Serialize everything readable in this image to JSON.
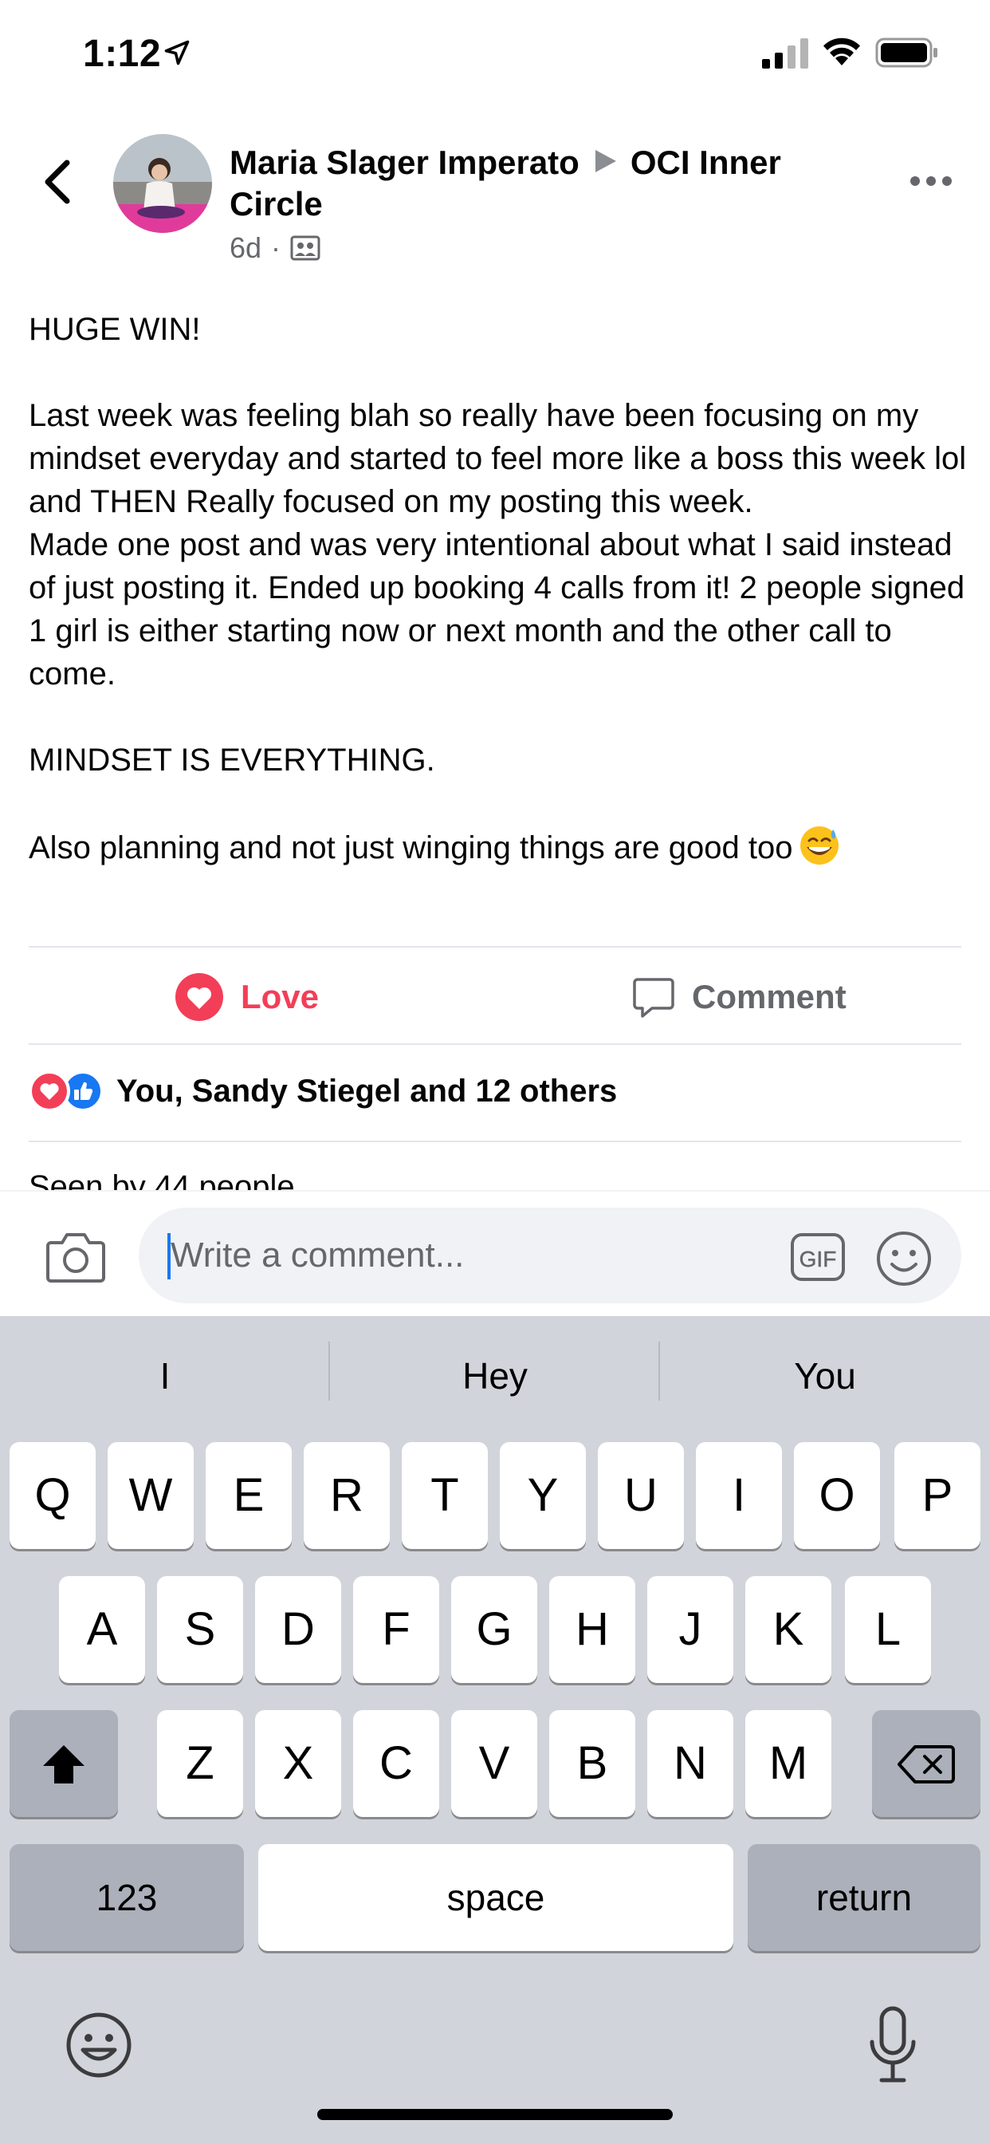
{
  "status_bar": {
    "time": "1:12"
  },
  "post": {
    "author": "Maria Slager Imperato",
    "group": "OCI Inner Circle",
    "age": "6d",
    "separator_dot": "·",
    "body": {
      "line_1": "HUGE WIN!",
      "para_1": "Last week was feeling blah so really have been focusing on my mindset everyday and started to feel more like a boss this week lol and THEN Really focused on my posting this week.",
      "para_2": "Made one post and was very intentional about what I said instead of just posting it. Ended up booking 4 calls from it! 2 people signed 1 girl is either starting now or next month and the other call to come.",
      "line_2": "MINDSET IS EVERYTHING.",
      "line_3": "Also planning and not just winging things are good too"
    }
  },
  "actions": {
    "love_label": "Love",
    "comment_label": "Comment"
  },
  "reactions": {
    "summary": "You, Sandy Stiegel and 12 others"
  },
  "seen_by": "Seen by 44 people",
  "comment_bar": {
    "placeholder": "Write a comment..."
  },
  "keyboard": {
    "suggestions": [
      "I",
      "Hey",
      "You"
    ],
    "row1": [
      "Q",
      "W",
      "E",
      "R",
      "T",
      "Y",
      "U",
      "I",
      "O",
      "P"
    ],
    "row2": [
      "A",
      "S",
      "D",
      "F",
      "G",
      "H",
      "J",
      "K",
      "L"
    ],
    "row3": [
      "Z",
      "X",
      "C",
      "V",
      "B",
      "N",
      "M"
    ],
    "numbers_label": "123",
    "space_label": "space",
    "return_label": "return"
  },
  "colors": {
    "love_red": "#f33e58",
    "like_blue": "#1877f2",
    "secondary_text": "#65676b",
    "keyboard_bg": "#d1d4da"
  },
  "icons": [
    "location-arrow-icon",
    "signal-icon",
    "wifi-icon",
    "battery-icon",
    "back-icon",
    "more-icon",
    "group-icon",
    "heart-icon",
    "comment-icon",
    "like-icon",
    "camera-icon",
    "gif-icon",
    "smiley-icon",
    "shift-icon",
    "delete-icon",
    "emoji-keyboard-icon",
    "microphone-icon"
  ]
}
